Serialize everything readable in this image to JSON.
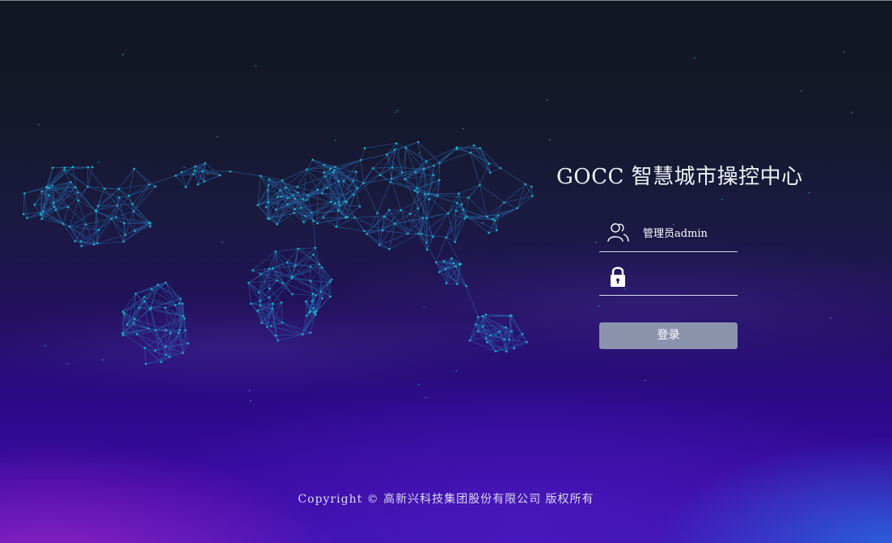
{
  "app": {
    "title": "GOCC 智慧城市操控中心"
  },
  "login": {
    "username_value": "管理员admin",
    "password_placeholder": "",
    "submit_label": "登录"
  },
  "footer": {
    "copyright": "Copyright © 高新兴科技集团股份有限公司 版权所有"
  },
  "icons": {
    "user": "users-icon",
    "password": "lock-icon"
  },
  "colors": {
    "button": "#8c93ad",
    "map_node": "#18b6c8",
    "map_line": "#2a6fb8"
  }
}
